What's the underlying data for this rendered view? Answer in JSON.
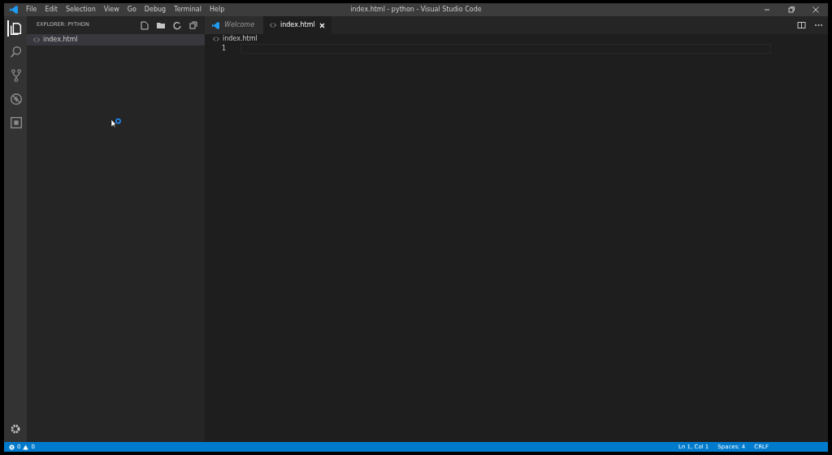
{
  "window": {
    "title": "index.html - python - Visual Studio Code"
  },
  "menu": [
    "File",
    "Edit",
    "Selection",
    "View",
    "Go",
    "Debug",
    "Terminal",
    "Help"
  ],
  "activity_bar": [
    {
      "kind": "files",
      "selected": true
    },
    {
      "kind": "search",
      "selected": false
    },
    {
      "kind": "source-control",
      "selected": false
    },
    {
      "kind": "debug",
      "selected": false
    },
    {
      "kind": "extensions",
      "selected": false
    }
  ],
  "explorer": {
    "title": "EXPLORER: PYTHON",
    "files": [
      {
        "name": "index.html",
        "selected": true
      }
    ]
  },
  "tabs": [
    {
      "label": "Welcome",
      "kind": "welcome",
      "preview": true,
      "selected": false
    },
    {
      "label": "index.html",
      "kind": "html",
      "preview": false,
      "selected": true
    }
  ],
  "breadcrumb": "index.html",
  "line_numbers": [
    "1"
  ],
  "status_bar": {
    "errors": "0",
    "warnings": "0",
    "right": [
      "Ln 1, Col 1",
      "Spaces: 4",
      "CRLF"
    ]
  }
}
